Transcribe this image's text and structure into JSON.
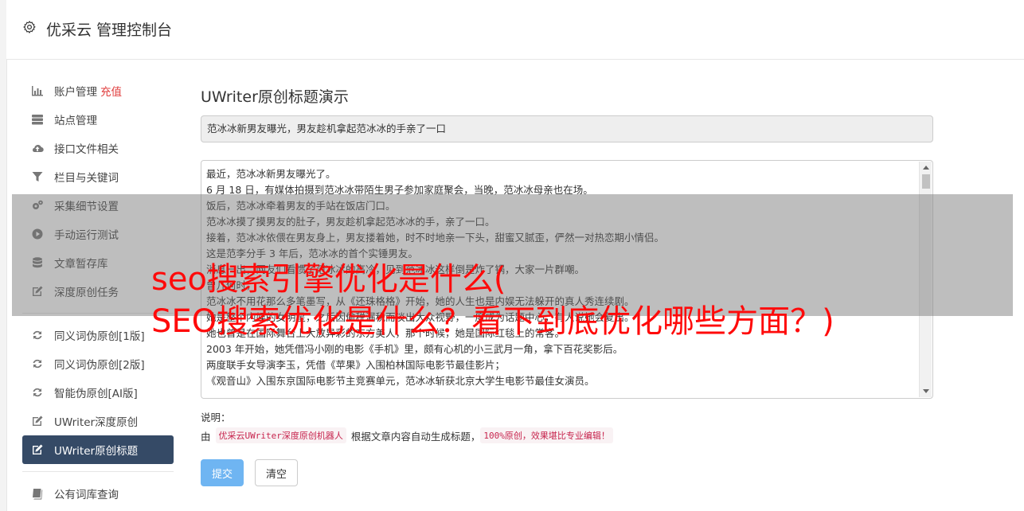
{
  "header": {
    "title": "优采云 管理控制台",
    "icon": "gear-icon"
  },
  "sidebar": {
    "items": [
      {
        "label": "账户管理",
        "extra": "充值",
        "icon": "bar-chart-icon"
      },
      {
        "label": "站点管理",
        "icon": "server-icon"
      },
      {
        "label": "接口文件相关",
        "icon": "cloud-upload-icon"
      },
      {
        "label": "栏目与关键词",
        "icon": "filter-icon"
      },
      {
        "label": "采集细节设置",
        "icon": "cogs-icon"
      },
      {
        "label": "手动运行测试",
        "icon": "play-circle-icon"
      },
      {
        "label": "文章暂存库",
        "icon": "database-icon"
      },
      {
        "label": "深度原创任务",
        "icon": "edit-icon"
      },
      {
        "label": "同义词伪原创[1版]",
        "icon": "refresh-icon"
      },
      {
        "label": "同义词伪原创[2版]",
        "icon": "refresh-icon"
      },
      {
        "label": "智能伪原创[AI版]",
        "icon": "refresh-icon"
      },
      {
        "label": "UWriter深度原创",
        "icon": "edit-icon"
      },
      {
        "label": "UWriter原创标题",
        "icon": "edit-icon",
        "active": true
      },
      {
        "label": "公有词库查询",
        "icon": "book-icon"
      }
    ]
  },
  "main": {
    "heading": "UWriter原创标题演示",
    "title_value": "范冰冰新男友曝光，男友趁机拿起范冰冰的手亲了一口",
    "article_lines": [
      "最近，范冰冰新男友曝光了。",
      "6 月 18 日，有媒体拍摄到范冰冰带陌生男子参加家庭聚会，当晚，范冰冰母亲也在场。",
      "饭后，范冰冰牵着男友的手站在饭店门口。",
      "范冰冰摸了摸男友的肚子，男友趁机拿起范冰冰的手，亲了一口。",
      "接着，范冰冰依偎在男友身上，男友搂着她，时不时地亲一下头，甜蜜又腻歪，俨然一对热恋期小情侣。",
      "这是范李分手 3 年后，范冰冰的首个实锤男友。",
      "消息一出，网友们看惯了范冰冰的高冷，见到范冰冰这样倒是炸了锅，大家一片群嘲。",
      "曾几何时，",
      "范冰冰不用花那么多笔墨写，从《还珠格格》开始，她的人生也是内娱无法躲开的真人秀连续剧。",
      "她是整个内娱的女明星，之后因偷税漏税而淡出大众视野，一度成为话题中心，有人说她会复出。",
      "她也曾是在国际舞台上大放异彩的东方美人，那个时候，她是国际红毯上的常客。",
      "2003 年开始，她凭借冯小刚的电影《手机》里，颇有心机的小三武月一角，拿下百花奖影后。",
      "两度联手女导演李玉，凭借《苹果》入围柏林国际电影节最佳影片；",
      "《观音山》入围东京国际电影节主竞赛单元，范冰冰斩获北京大学生电影节最佳女演员。"
    ],
    "note_label": "说明：",
    "note_prefix": "由",
    "note_code1": "优采云UWriter深度原创机器人",
    "note_middle": "根据文章内容自动生成标题，",
    "note_code2": "100%原创，效果堪比专业编辑！",
    "submit_label": "提交",
    "clear_label": "清空"
  },
  "overlay": {
    "line1": "seo搜索引擎优化是什么(",
    "line2": "SEO搜索优化是什么？看下到底优化哪些方面？)"
  },
  "colors": {
    "active_nav": "#354a66",
    "submit": "#6fb5f2",
    "overlay_text": "#ff0a0a",
    "recharge": "#e03c3c"
  }
}
